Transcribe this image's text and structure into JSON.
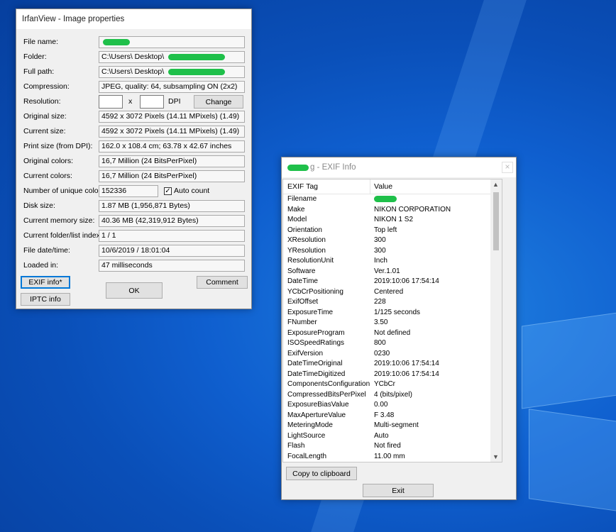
{
  "image_props": {
    "title": "IrfanView - Image properties",
    "fields": [
      {
        "label": "File name:",
        "value": ""
      },
      {
        "label": "Folder:",
        "value": "C:\\Users\\ Desktop\\"
      },
      {
        "label": "Full path:",
        "value": "C:\\Users\\ Desktop\\"
      },
      {
        "label": "Compression:",
        "value": "JPEG, quality: 64, subsampling ON (2x2)"
      },
      {
        "label": "Resolution:",
        "value": ""
      },
      {
        "label": "Original size:",
        "value": "4592 x 3072  Pixels (14.11 MPixels) (1.49)"
      },
      {
        "label": "Current size:",
        "value": "4592 x 3072  Pixels (14.11 MPixels) (1.49)"
      },
      {
        "label": "Print size (from DPI):",
        "value": "162.0 x 108.4 cm; 63.78 x 42.67 inches"
      },
      {
        "label": "Original colors:",
        "value": "16,7 Million   (24 BitsPerPixel)"
      },
      {
        "label": "Current colors:",
        "value": "16,7 Million   (24 BitsPerPixel)"
      },
      {
        "label": "Number of unique colors:",
        "value": "152336"
      },
      {
        "label": "Disk size:",
        "value": "1.87 MB (1,956,871 Bytes)"
      },
      {
        "label": "Current memory size:",
        "value": "40.36  MB (42,319,912 Bytes)"
      },
      {
        "label": "Current folder/list index:",
        "value": "1  /  1"
      },
      {
        "label": "File date/time:",
        "value": "10/6/2019 / 18:01:04"
      },
      {
        "label": "Loaded in:",
        "value": "47 milliseconds"
      }
    ],
    "resolution_x_sep": "x",
    "dpi_label": "DPI",
    "change_button": "Change",
    "auto_count_label": "Auto count",
    "auto_count_checked": true,
    "exif_button": "EXIF info*",
    "iptc_button": "IPTC info",
    "ok_button": "OK",
    "comment_button": "Comment"
  },
  "exif_window": {
    "title_suffix": "g - EXIF Info",
    "close_glyph": "×",
    "col_tag": "EXIF Tag",
    "col_value": "Value",
    "rows": [
      {
        "tag": "Filename",
        "value": ""
      },
      {
        "tag": "Make",
        "value": "NIKON CORPORATION"
      },
      {
        "tag": "Model",
        "value": "NIKON 1 S2"
      },
      {
        "tag": "Orientation",
        "value": "Top left"
      },
      {
        "tag": "XResolution",
        "value": "300"
      },
      {
        "tag": "YResolution",
        "value": "300"
      },
      {
        "tag": "ResolutionUnit",
        "value": "Inch"
      },
      {
        "tag": "Software",
        "value": "Ver.1.01"
      },
      {
        "tag": "DateTime",
        "value": "2019:10:06 17:54:14"
      },
      {
        "tag": "YCbCrPositioning",
        "value": "Centered"
      },
      {
        "tag": "ExifOffset",
        "value": "228"
      },
      {
        "tag": "ExposureTime",
        "value": "1/125 seconds"
      },
      {
        "tag": "FNumber",
        "value": "3.50"
      },
      {
        "tag": "ExposureProgram",
        "value": "Not defined"
      },
      {
        "tag": "ISOSpeedRatings",
        "value": "800"
      },
      {
        "tag": "ExifVersion",
        "value": "0230"
      },
      {
        "tag": "DateTimeOriginal",
        "value": "2019:10:06 17:54:14"
      },
      {
        "tag": "DateTimeDigitized",
        "value": "2019:10:06 17:54:14"
      },
      {
        "tag": "ComponentsConfiguration",
        "value": "YCbCr"
      },
      {
        "tag": "CompressedBitsPerPixel",
        "value": "4 (bits/pixel)"
      },
      {
        "tag": "ExposureBiasValue",
        "value": "0.00"
      },
      {
        "tag": "MaxApertureValue",
        "value": "F 3.48"
      },
      {
        "tag": "MeteringMode",
        "value": "Multi-segment"
      },
      {
        "tag": "LightSource",
        "value": "Auto"
      },
      {
        "tag": "Flash",
        "value": "Not fired"
      },
      {
        "tag": "FocalLength",
        "value": "11.00 mm"
      }
    ],
    "copy_button": "Copy to clipboard",
    "exit_button": "Exit"
  }
}
